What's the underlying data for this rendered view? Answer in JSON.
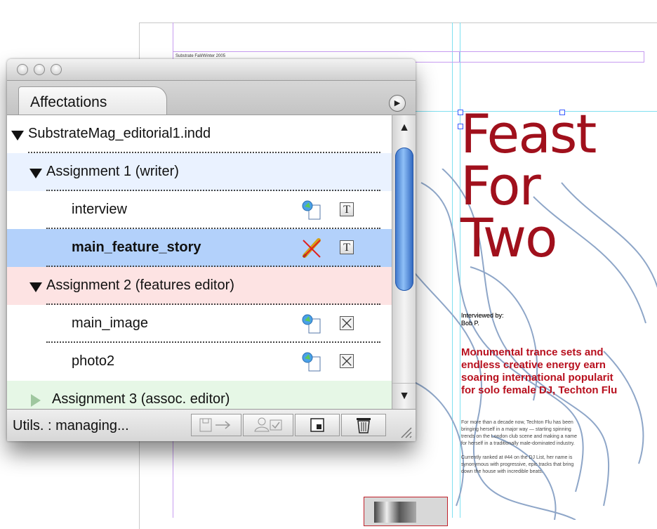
{
  "document": {
    "slug": "Substrate Fall/Winter 2005",
    "headline": [
      "Feast",
      "For",
      "Two"
    ],
    "byline": "Interviewed by:\nBob P.",
    "subhead": [
      "Monumental trance sets and",
      "endless creative energy earn",
      "soaring international popularit",
      "for solo female DJ, Techton Flu"
    ],
    "body": [
      "For more than a decade now, Techton Flu has been",
      "bringing herself in a major way — starting spinning",
      "trends on the London club scene and making a name",
      "for herself in a traditionally male-dominated industry.",
      "",
      "Currently ranked at #44 on the DJ List, her name is",
      "synonymous with progressive, epic tracks that bring",
      "down the house with incredible beats."
    ]
  },
  "panel": {
    "tab_title": "Affectations",
    "menu_icon": "panel-menu-icon",
    "scroll_up": "▲",
    "scroll_down": "▼",
    "status": "Utils. : managing...",
    "rows": [
      {
        "label": "SubstrateMag_editorial1.indd",
        "type": "file"
      },
      {
        "label": "Assignment 1 (writer)",
        "type": "assignment",
        "color": "#eaf2ff"
      },
      {
        "label": "interview",
        "type": "item",
        "status_icon": "linked-doc-icon",
        "kind_icon": "text-frame-icon",
        "kind_glyph": "T"
      },
      {
        "label": "main_feature_story",
        "type": "item",
        "selected": true,
        "status_icon": "pencil-edit-icon",
        "kind_icon": "text-frame-icon",
        "kind_glyph": "T"
      },
      {
        "label": "Assignment 2 (features editor)",
        "type": "assignment",
        "color": "#fde3e3"
      },
      {
        "label": "main_image",
        "type": "item",
        "status_icon": "linked-doc-icon",
        "kind_icon": "graphic-frame-icon"
      },
      {
        "label": "photo2",
        "type": "item",
        "status_icon": "linked-doc-icon",
        "kind_icon": "graphic-frame-icon"
      },
      {
        "label": "Assignment 3 (assoc. editor)",
        "type": "assignment",
        "color": "#e6f7e6"
      }
    ]
  },
  "colors": {
    "headline": "#a0101c",
    "selection": "#b3d1fb",
    "guide": "#7fe0f0"
  }
}
